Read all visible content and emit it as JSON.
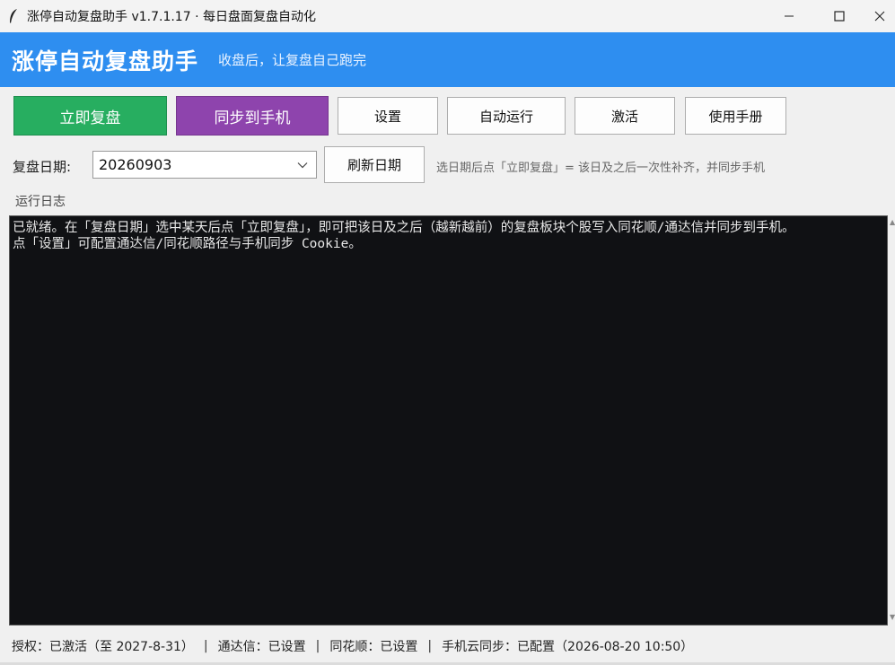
{
  "window": {
    "title": "涨停自动复盘助手 v1.7.1.17 · 每日盘面复盘自动化",
    "icon": "feather-icon"
  },
  "banner": {
    "title": "涨停自动复盘助手",
    "subtitle": "收盘后，让复盘自己跑完",
    "color": "#2e8ef0"
  },
  "toolbar": {
    "review_label": "立即复盘",
    "sync_label": "同步到手机",
    "settings_label": "设置",
    "autorun_label": "自动运行",
    "activate_label": "激活",
    "manual_label": "使用手册",
    "review_color": "#27ae60",
    "sync_color": "#8e44ad"
  },
  "date_row": {
    "label": "复盘日期:",
    "value": "20260903",
    "refresh_label": "刷新日期",
    "hint": "选日期后点「立即复盘」= 该日及之后一次性补齐，并同步手机"
  },
  "log": {
    "label": "运行日志",
    "lines": [
      "已就绪。在「复盘日期」选中某天后点「立即复盘」，即可把该日及之后（越新越前）的复盘板块个股写入同花顺/通达信并同步到手机。",
      "点「设置」可配置通达信/同花顺路径与手机同步 Cookie。"
    ]
  },
  "status": {
    "license": "授权：已激活（至 2027-8-31）",
    "tdx": "通达信：已设置",
    "ths": "同花顺：已设置",
    "cloud": "手机云同步：已配置（2026-08-20 10:50）",
    "sep": "|"
  }
}
